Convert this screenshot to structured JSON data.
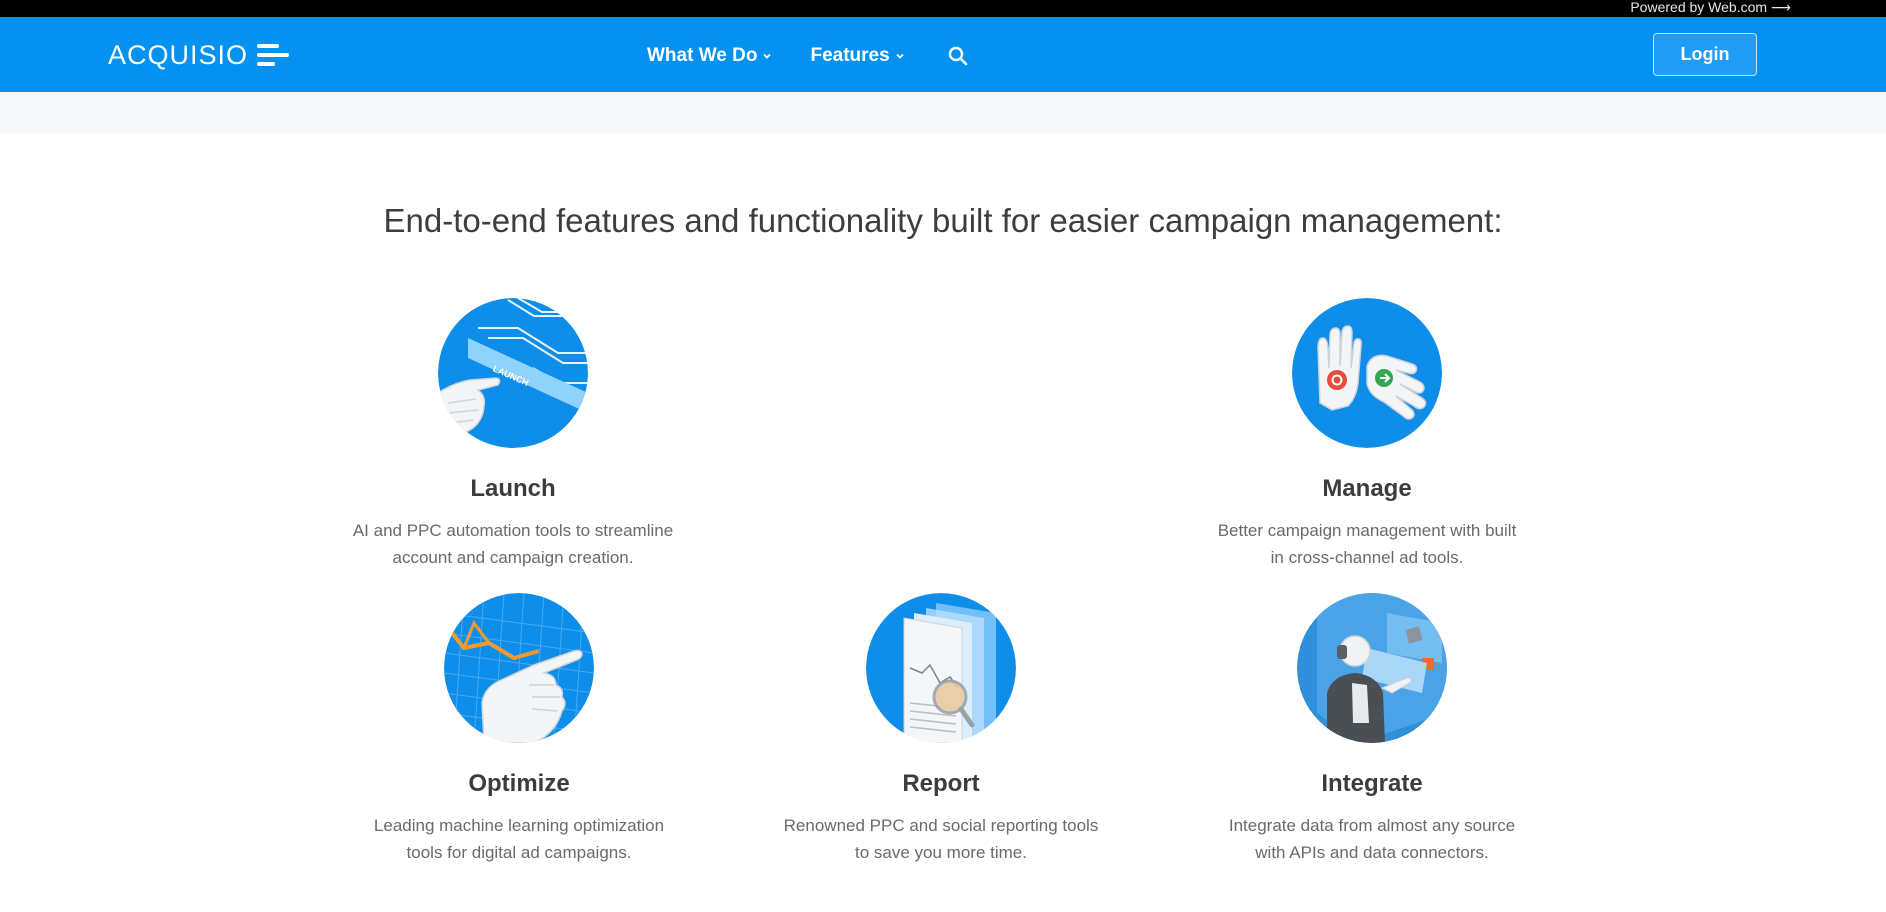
{
  "topbar": {
    "powered": "Powered by Web.com ⟶"
  },
  "nav": {
    "logo": "ACQUISIO",
    "items": [
      {
        "label": "What We Do"
      },
      {
        "label": "Features"
      }
    ],
    "login": "Login"
  },
  "headline": "End-to-end features and functionality built for easier campaign management:",
  "features": [
    {
      "title": "Launch",
      "desc_line1": "AI and PPC automation tools to streamline",
      "desc_line2": "account and campaign creation.",
      "icon": "launch-illustration",
      "badge": "LAUNCH"
    },
    {
      "title": "Manage",
      "desc_line1": "Better campaign management with built",
      "desc_line2": "in cross-channel ad tools.",
      "icon": "manage-illustration"
    },
    {
      "title": "Optimize",
      "desc_line1": "Leading machine learning optimization",
      "desc_line2": "tools for digital ad campaigns.",
      "icon": "optimize-illustration"
    },
    {
      "title": "Report",
      "desc_line1": "Renowned PPC and social reporting tools",
      "desc_line2": "to save you more time.",
      "icon": "report-illustration"
    },
    {
      "title": "Integrate",
      "desc_line1": "Integrate data from almost any source",
      "desc_line2": "with APIs and data connectors.",
      "icon": "integrate-illustration"
    }
  ],
  "colors": {
    "brand": "#0591f0",
    "topbar": "#000000",
    "heading": "#3d3d3d",
    "body": "#6a6a6a"
  }
}
